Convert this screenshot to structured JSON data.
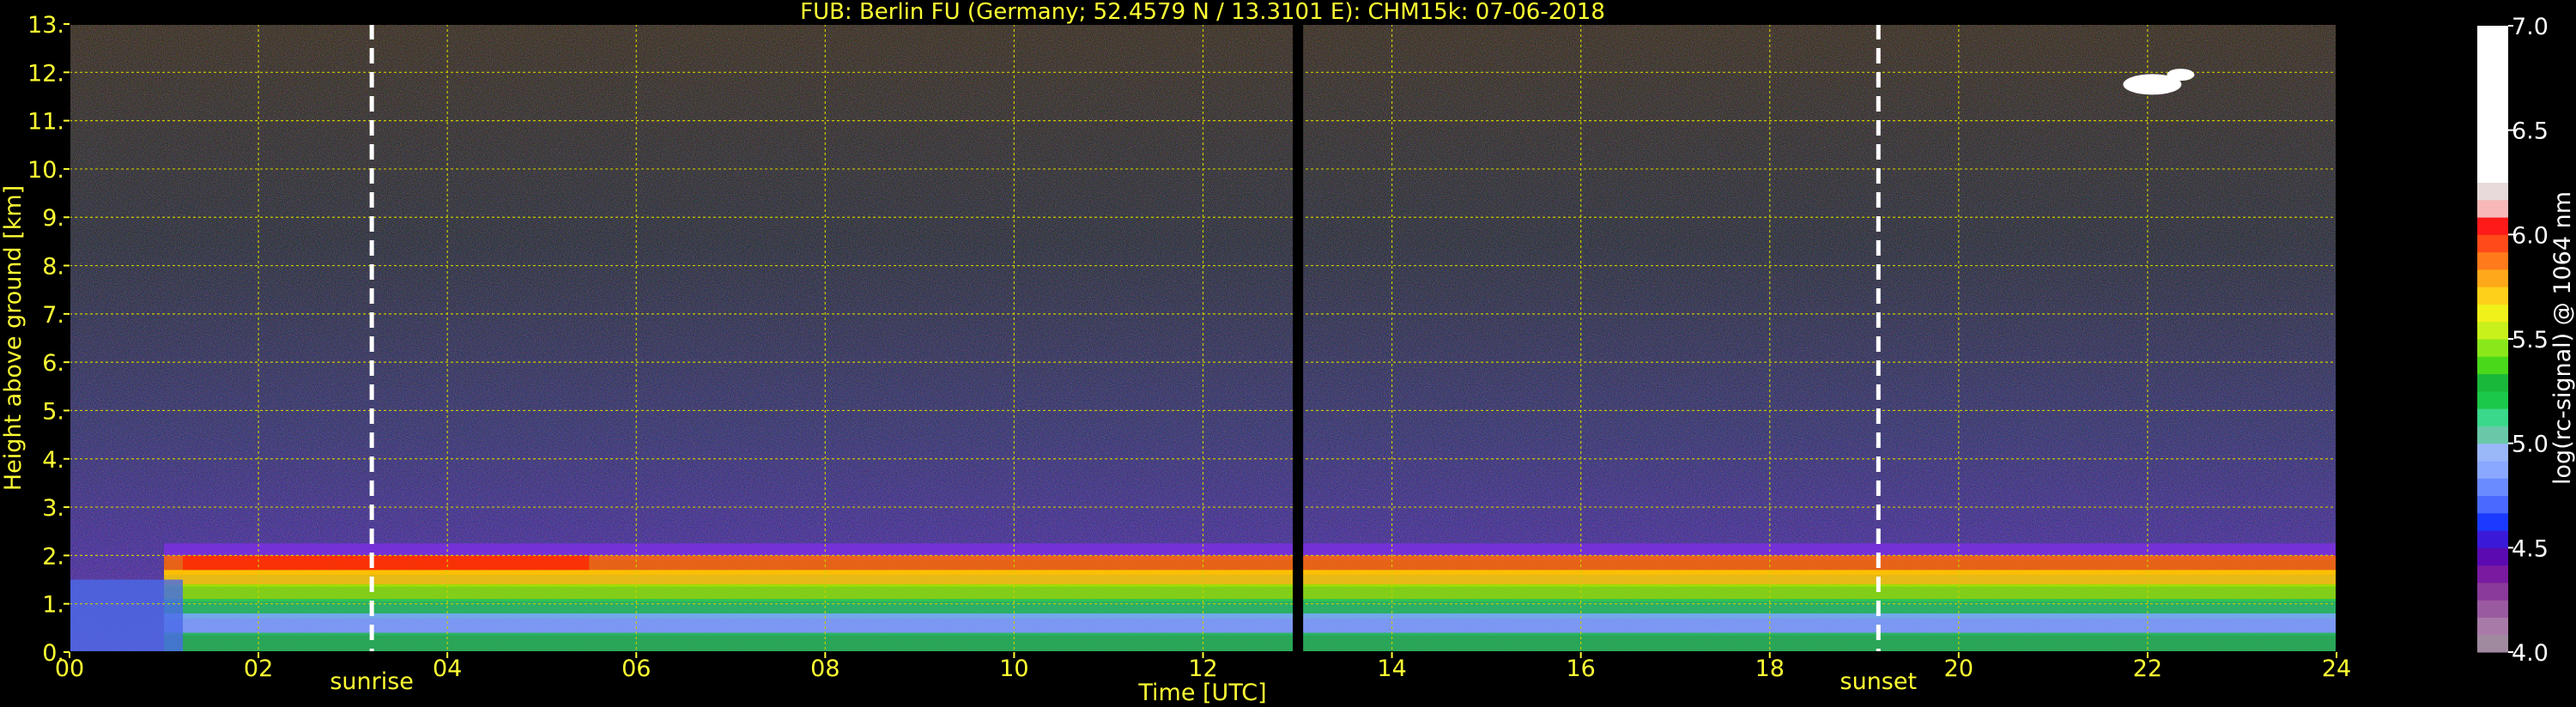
{
  "chart_data": {
    "type": "heatmap",
    "title": "FUB: Berlin FU (Germany; 52.4579 N / 13.3101 E):    CHM15k: 07-06-2018",
    "xlabel": "Time [UTC]",
    "ylabel": "Height above ground [km]",
    "xlim": [
      0,
      24
    ],
    "ylim": [
      0,
      13
    ],
    "x_ticks": [
      0,
      2,
      4,
      6,
      8,
      10,
      12,
      14,
      16,
      18,
      20,
      22,
      24
    ],
    "x_tick_labels": [
      "00",
      "02",
      "04",
      "06",
      "08",
      "10",
      "12",
      "14",
      "16",
      "18",
      "20",
      "22",
      "24"
    ],
    "y_ticks": [
      0,
      1,
      2,
      3,
      4,
      5,
      6,
      7,
      8,
      9,
      10,
      11,
      12,
      13
    ],
    "y_tick_labels": [
      "0.",
      "1.",
      "2.",
      "3.",
      "4.",
      "5.",
      "6.",
      "7.",
      "8.",
      "9.",
      "10.",
      "11.",
      "12.",
      "13."
    ],
    "grid": true,
    "colorbar": {
      "label": "log(rc-signal) @ 1064 nm",
      "range": [
        4.0,
        7.0
      ],
      "tick_values": [
        4.0,
        4.5,
        5.0,
        5.5,
        6.0,
        6.5,
        7.0
      ],
      "tick_labels": [
        "4.0",
        "4.5",
        "5.0",
        "5.5",
        "6.0",
        "6.5",
        "7.0"
      ]
    },
    "markers": [
      {
        "label": "sunrise",
        "x": 3.2
      },
      {
        "label": "sunset",
        "x": 19.15
      }
    ],
    "data_gap": {
      "x": [
        12.95,
        13.06
      ]
    },
    "colors": {
      "text": "#ffff33",
      "grid": "#cccc00",
      "background": "#000000"
    }
  }
}
